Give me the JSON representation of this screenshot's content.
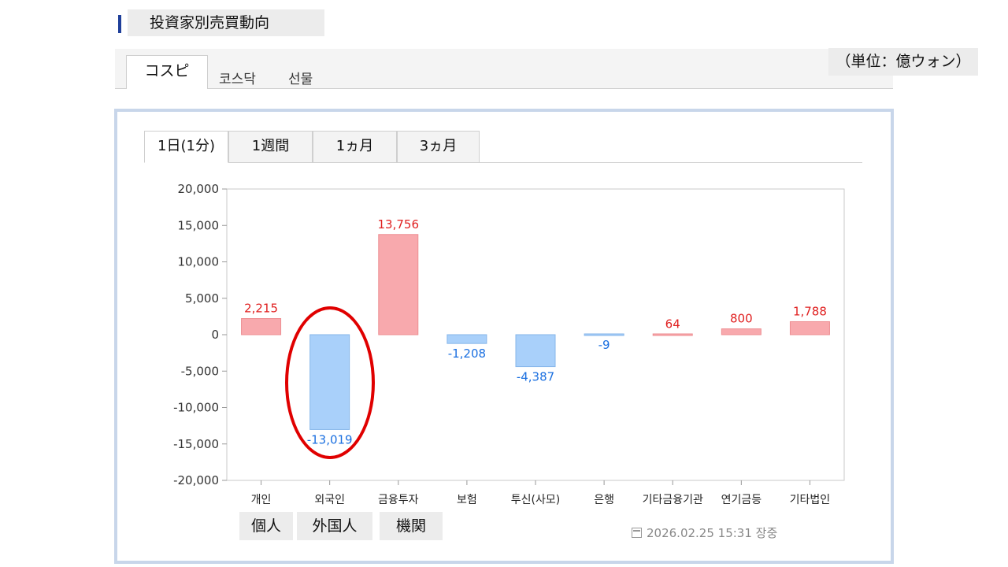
{
  "page_title": "投資家別売買動向",
  "unit_label": "（単位：億ウォン）",
  "market_tabs": [
    {
      "label": "コスピ",
      "active": true
    },
    {
      "label": "코스닥",
      "active": false
    },
    {
      "label": "선물",
      "active": false
    }
  ],
  "period_tabs": [
    {
      "label": "1日(1分)",
      "active": true
    },
    {
      "label": "1週間",
      "active": false
    },
    {
      "label": "1ヵ月",
      "active": false
    },
    {
      "label": "3ヵ月",
      "active": false
    }
  ],
  "jp_labels": [
    "個人",
    "外国人",
    "機関"
  ],
  "timestamp": "2026.02.25 15:31 장중",
  "colors": {
    "positive_fill": "#f8a9ad",
    "positive_stroke": "#ee8e92",
    "positive_text": "#e02020",
    "negative_fill": "#a9d0fa",
    "negative_stroke": "#86b6ea",
    "negative_text": "#1a6fe0",
    "highlight": "#e00000"
  },
  "chart_data": {
    "type": "bar",
    "categories": [
      "개인",
      "외국인",
      "금융투자",
      "보험",
      "투신(사모)",
      "은행",
      "기타금융기관",
      "연기금등",
      "기타법인"
    ],
    "values": [
      2215,
      -13019,
      13756,
      -1208,
      -4387,
      -9,
      64,
      800,
      1788
    ],
    "value_labels": [
      "2,215",
      "-13,019",
      "13,756",
      "-1,208",
      "-4,387",
      "-9",
      "64",
      "800",
      "1,788"
    ],
    "ylim": [
      -20000,
      20000
    ],
    "yticks": [
      20000,
      15000,
      10000,
      5000,
      0,
      -5000,
      -10000,
      -15000,
      -20000
    ],
    "ytick_labels": [
      "20,000",
      "15,000",
      "10,000",
      "5,000",
      "0",
      "-5,000",
      "-10,000",
      "-15,000",
      "-20,000"
    ],
    "grid": false,
    "title": "",
    "xlabel": "",
    "ylabel": "",
    "highlighted_category": "외국인"
  }
}
